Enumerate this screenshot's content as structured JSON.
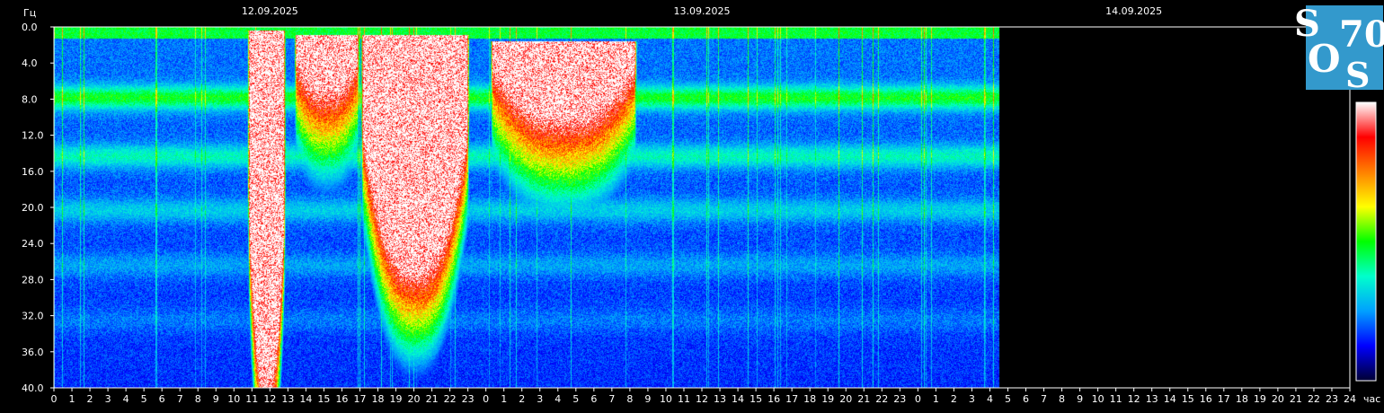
{
  "chart_data": {
    "type": "heatmap",
    "title": "",
    "ylabel": "Гц",
    "xlabel": "час",
    "dates": [
      "12.09.2025",
      "13.09.2025",
      "14.09.2025"
    ],
    "ylim": [
      0,
      40
    ],
    "yticks": [
      "0.0",
      "4.0",
      "8.0",
      "12.0",
      "16.0",
      "20.0",
      "24.0",
      "28.0",
      "32.0",
      "36.0",
      "40.0"
    ],
    "xticks": [
      "0",
      "1",
      "2",
      "3",
      "4",
      "5",
      "6",
      "7",
      "8",
      "9",
      "10",
      "11",
      "12",
      "13",
      "14",
      "15",
      "16",
      "17",
      "18",
      "19",
      "20",
      "21",
      "22",
      "23",
      "0",
      "1",
      "2",
      "3",
      "4",
      "5",
      "6",
      "7",
      "8",
      "9",
      "10",
      "11",
      "12",
      "13",
      "14",
      "15",
      "16",
      "17",
      "18",
      "19",
      "20",
      "21",
      "22",
      "23",
      "0",
      "1",
      "2",
      "3",
      "4",
      "5",
      "6",
      "7",
      "8",
      "9",
      "10",
      "11",
      "12",
      "13",
      "14",
      "15",
      "16",
      "17",
      "18",
      "19",
      "20",
      "21",
      "22",
      "23",
      "24"
    ],
    "data_end_hour": 52.5,
    "colorscale": [
      "#000033",
      "#0000ff",
      "#00a0ff",
      "#00ffcc",
      "#00ff00",
      "#ffff00",
      "#ff8000",
      "#ff0000",
      "#ffffff"
    ],
    "resonance_bands_hz": [
      7.8,
      14.3,
      20.3,
      26.4,
      32.5
    ],
    "intensity_events": [
      {
        "start_hour": 10.7,
        "end_hour": 12.9,
        "top_hz": 0.3,
        "white_down_to_hz": 40
      },
      {
        "start_hour": 13.3,
        "end_hour": 17.0,
        "top_hz": 0.8,
        "white_down_to_hz": 7
      },
      {
        "start_hour": 17.0,
        "end_hour": 23.1,
        "top_hz": 0.8,
        "white_down_to_hz": 27
      },
      {
        "start_hour": 24.2,
        "end_hour": 32.4,
        "top_hz": 1.5,
        "white_down_to_hz": 10
      }
    ]
  },
  "logo": {
    "text_top": "S",
    "text_top_right": "70",
    "text_bottom": "O",
    "text_bottom_right": "S",
    "color": "#3399cc"
  }
}
